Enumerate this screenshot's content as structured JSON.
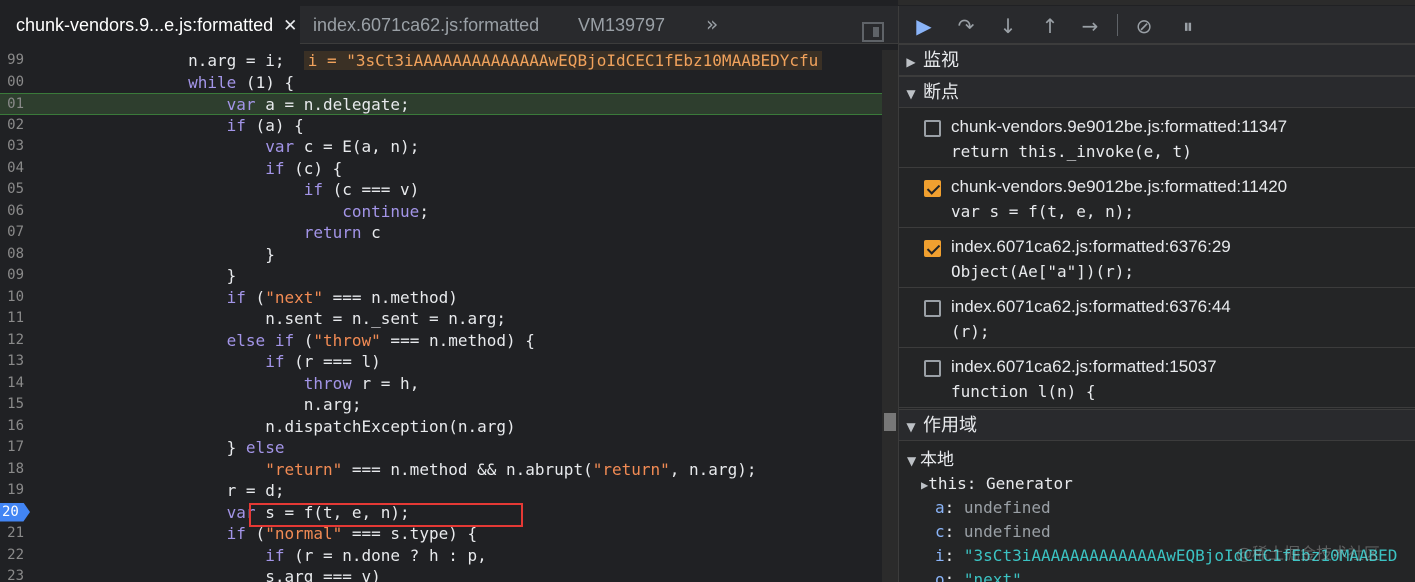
{
  "tabs": [
    {
      "label": "chunk-vendors.9...e.js:formatted",
      "active": true
    },
    {
      "label": "index.6071ca62.js:formatted",
      "active": false
    },
    {
      "label": "VM139797",
      "active": false
    }
  ],
  "tab_more": "»",
  "code_lines": [
    {
      "num": "99",
      "text": "                n.arg = i;",
      "inline": "i = \"3sCt3iAAAAAAAAAAAAAAwEQBjoIdCEC1fEbz10MAABEDYcfu"
    },
    {
      "num": "00",
      "text": "                while (1) {"
    },
    {
      "num": "01",
      "text": "                    var a = n.delegate;",
      "current": true
    },
    {
      "num": "02",
      "text": "                    if (a) {"
    },
    {
      "num": "03",
      "text": "                        var c = E(a, n);"
    },
    {
      "num": "04",
      "text": "                        if (c) {"
    },
    {
      "num": "05",
      "text": "                            if (c === v)"
    },
    {
      "num": "06",
      "text": "                                continue;"
    },
    {
      "num": "07",
      "text": "                            return c"
    },
    {
      "num": "08",
      "text": "                        }"
    },
    {
      "num": "09",
      "text": "                    }"
    },
    {
      "num": "10",
      "text": "                    if (\"next\" === n.method)"
    },
    {
      "num": "11",
      "text": "                        n.sent = n._sent = n.arg;"
    },
    {
      "num": "12",
      "text": "                    else if (\"throw\" === n.method) {"
    },
    {
      "num": "13",
      "text": "                        if (r === l)"
    },
    {
      "num": "14",
      "text": "                            throw r = h,"
    },
    {
      "num": "15",
      "text": "                            n.arg;"
    },
    {
      "num": "16",
      "text": "                        n.dispatchException(n.arg)"
    },
    {
      "num": "17",
      "text": "                    } else"
    },
    {
      "num": "18",
      "text": "                        \"return\" === n.method && n.abrupt(\"return\", n.arg);"
    },
    {
      "num": "19",
      "text": "                    r = d;"
    },
    {
      "num": "20",
      "text": "                    var s = f(t, e, n);",
      "breakpoint": true
    },
    {
      "num": "21",
      "text": "                    if (\"normal\" === s.type) {"
    },
    {
      "num": "22",
      "text": "                        if (r = n.done ? h : p,"
    },
    {
      "num": "23",
      "text": "                        s.arg === v)"
    }
  ],
  "sections": {
    "watch": "监视",
    "breakpoints": "断点",
    "scope": "作用域",
    "local": "本地"
  },
  "breakpoints": [
    {
      "location": "chunk-vendors.9e9012be.js:formatted:11347",
      "source": "return this._invoke(e, t)",
      "checked": false
    },
    {
      "location": "chunk-vendors.9e9012be.js:formatted:11420",
      "source": "var s = f(t, e, n);",
      "checked": true
    },
    {
      "location": "index.6071ca62.js:formatted:6376:29",
      "source": "Object(Ae[\"a\"])(r);",
      "checked": true
    },
    {
      "location": "index.6071ca62.js:formatted:6376:44",
      "source": "(r);",
      "checked": false
    },
    {
      "location": "index.6071ca62.js:formatted:15037",
      "source": "function l(n) {",
      "checked": false
    }
  ],
  "scope_vars": [
    {
      "key": "this",
      "value": "Generator",
      "kind": "plain",
      "expandable": true
    },
    {
      "key": "a",
      "value": "undefined",
      "kind": "undef"
    },
    {
      "key": "c",
      "value": "undefined",
      "kind": "undef"
    },
    {
      "key": "i",
      "value": "\"3sCt3iAAAAAAAAAAAAAAwEQBjoIdCEC1fEbz10MAABED",
      "kind": "str"
    },
    {
      "key": "o",
      "value": "\"next\"",
      "kind": "str"
    }
  ],
  "watermark": "@稀土掘金技术社区",
  "colors": {
    "background": "#202124",
    "keyword": "#a395e8",
    "string": "#f28b54",
    "current_line": "#2e3e2e",
    "breakpoint_marker": "#4285f4",
    "highlight_box": "#e53935",
    "checkbox_checked": "#f0a030"
  },
  "toolbar_icons": [
    "resume-icon",
    "step-over-icon",
    "step-into-icon",
    "step-out-icon",
    "step-icon",
    "deactivate-breakpoints-icon",
    "pause-on-exceptions-icon"
  ]
}
